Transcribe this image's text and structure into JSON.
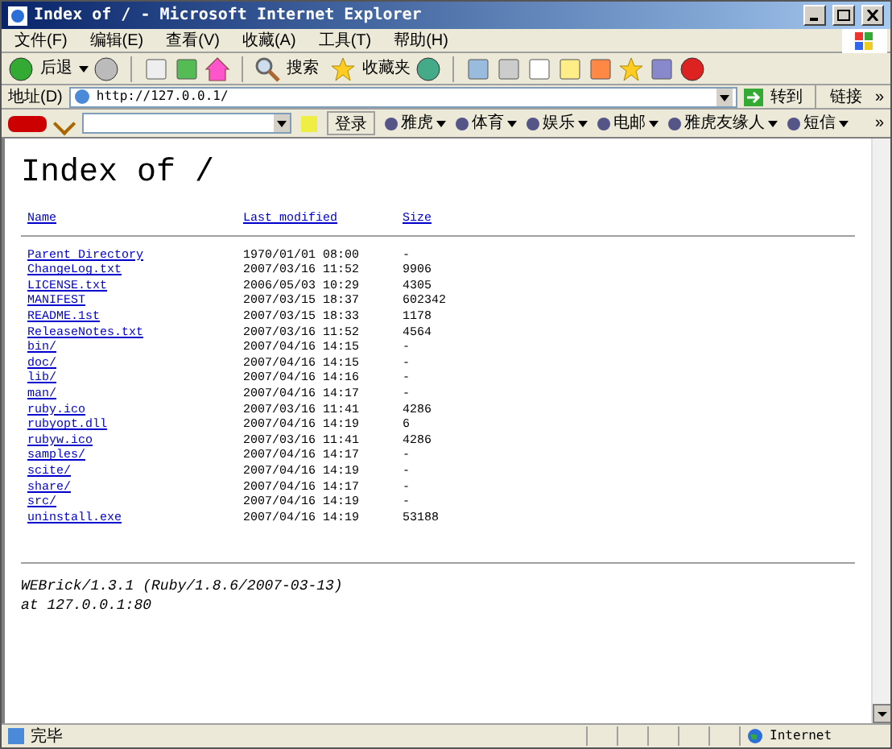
{
  "window": {
    "title": "Index of / - Microsoft Internet Explorer"
  },
  "menu": [
    "文件(F)",
    "编辑(E)",
    "查看(V)",
    "收藏(A)",
    "工具(T)",
    "帮助(H)"
  ],
  "toolbar": {
    "back": "后退",
    "search": "搜索",
    "favorites": "收藏夹"
  },
  "address": {
    "label": "地址(D)",
    "value": "http://127.0.0.1/",
    "go": "转到",
    "links": "链接",
    "more": "»"
  },
  "yahoo_bar": {
    "login": "登录",
    "items": [
      "雅虎",
      "体育",
      "娱乐",
      "电邮",
      "雅虎友缘人",
      "短信"
    ],
    "more": "»"
  },
  "page": {
    "heading": "Index of /",
    "columns": [
      "Name",
      "Last modified",
      "Size"
    ],
    "rows": [
      {
        "name": "Parent Directory",
        "modified": "1970/01/01 08:00",
        "size": "-"
      },
      {
        "name": "ChangeLog.txt",
        "modified": "2007/03/16 11:52",
        "size": "9906"
      },
      {
        "name": "LICENSE.txt",
        "modified": "2006/05/03 10:29",
        "size": "4305"
      },
      {
        "name": "MANIFEST",
        "modified": "2007/03/15 18:37",
        "size": "602342"
      },
      {
        "name": "README.1st",
        "modified": "2007/03/15 18:33",
        "size": "1178"
      },
      {
        "name": "ReleaseNotes.txt",
        "modified": "2007/03/16 11:52",
        "size": "4564"
      },
      {
        "name": "bin/",
        "modified": "2007/04/16 14:15",
        "size": "-"
      },
      {
        "name": "doc/",
        "modified": "2007/04/16 14:15",
        "size": "-"
      },
      {
        "name": "lib/",
        "modified": "2007/04/16 14:16",
        "size": "-"
      },
      {
        "name": "man/",
        "modified": "2007/04/16 14:17",
        "size": "-"
      },
      {
        "name": "ruby.ico",
        "modified": "2007/03/16 11:41",
        "size": "4286"
      },
      {
        "name": "rubyopt.dll",
        "modified": "2007/04/16 14:19",
        "size": "6"
      },
      {
        "name": "rubyw.ico",
        "modified": "2007/03/16 11:41",
        "size": "4286"
      },
      {
        "name": "samples/",
        "modified": "2007/04/16 14:17",
        "size": "-"
      },
      {
        "name": "scite/",
        "modified": "2007/04/16 14:19",
        "size": "-"
      },
      {
        "name": "share/",
        "modified": "2007/04/16 14:17",
        "size": "-"
      },
      {
        "name": "src/",
        "modified": "2007/04/16 14:19",
        "size": "-"
      },
      {
        "name": "uninstall.exe",
        "modified": "2007/04/16 14:19",
        "size": "53188"
      }
    ],
    "footer": [
      "WEBrick/1.3.1 (Ruby/1.8.6/2007-03-13)",
      "at 127.0.0.1:80"
    ]
  },
  "status_bar": {
    "text": "完毕",
    "zone": "Internet"
  }
}
